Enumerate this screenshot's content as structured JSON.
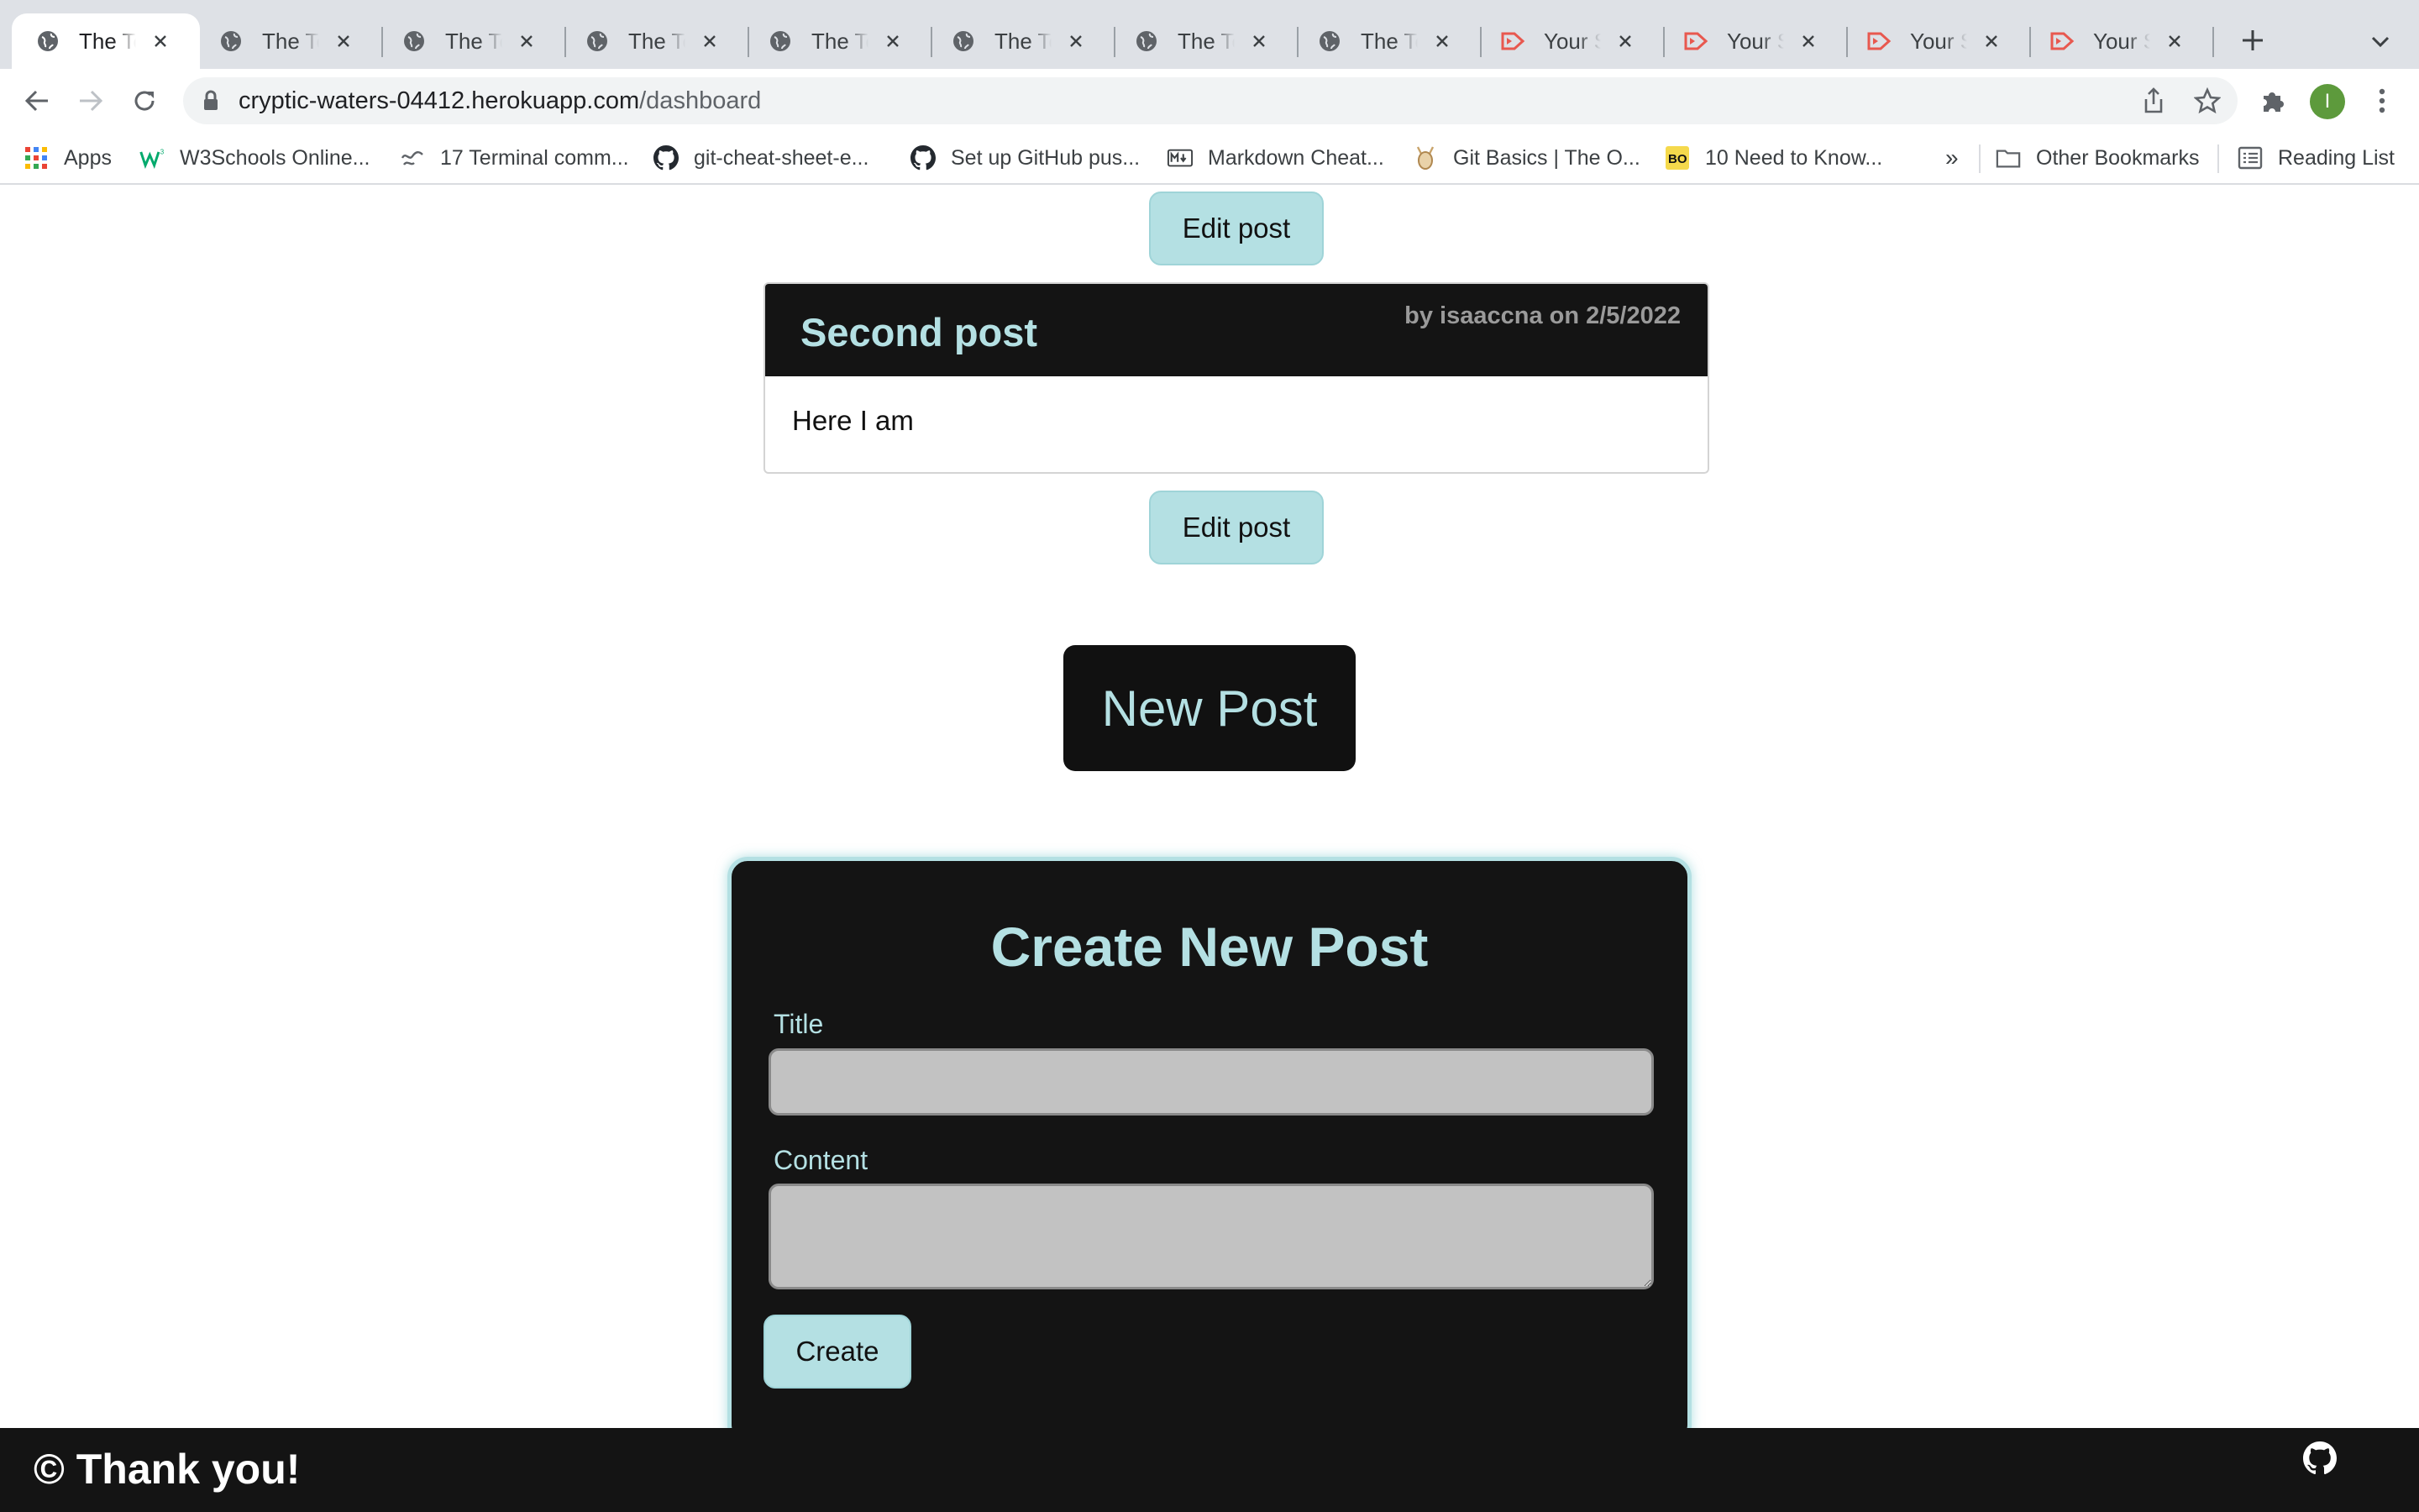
{
  "browser": {
    "tabs": [
      {
        "title": "The Tech Blog",
        "icon": "globe-icon",
        "active": true
      },
      {
        "title": "The Tech Blog",
        "icon": "globe-icon",
        "active": false
      },
      {
        "title": "The Tech Blog",
        "icon": "globe-icon",
        "active": false
      },
      {
        "title": "The Tech Blog",
        "icon": "globe-icon",
        "active": false
      },
      {
        "title": "The Tech Blog",
        "icon": "globe-icon",
        "active": false
      },
      {
        "title": "The Tech Blog",
        "icon": "globe-icon",
        "active": false
      },
      {
        "title": "The Tech Blog",
        "icon": "globe-icon",
        "active": false
      },
      {
        "title": "The Tech Blog",
        "icon": "globe-icon",
        "active": false
      },
      {
        "title": "Your Screencastify",
        "icon": "screencastify-icon",
        "active": false
      },
      {
        "title": "Your Screencastify",
        "icon": "screencastify-icon",
        "active": false
      },
      {
        "title": "Your Screencastify",
        "icon": "screencastify-icon",
        "active": false
      },
      {
        "title": "Your Screencastify",
        "icon": "screencastify-icon",
        "active": false
      }
    ],
    "address": {
      "host": "cryptic-waters-04412.herokuapp.com",
      "path": "/dashboard"
    },
    "profile_initial": "I",
    "bookmarks": [
      {
        "label": "Apps",
        "icon": "apps-grid-icon"
      },
      {
        "label": "W3Schools Online...",
        "icon": "w3schools-icon"
      },
      {
        "label": "17 Terminal comm...",
        "icon": "terminal-icon"
      },
      {
        "label": "git-cheat-sheet-e...",
        "icon": "github-icon"
      },
      {
        "label": "Set up GitHub pus...",
        "icon": "github-icon"
      },
      {
        "label": "Markdown Cheat...",
        "icon": "markdown-icon"
      },
      {
        "label": "Git Basics | The O...",
        "icon": "odin-icon"
      },
      {
        "label": "10 Need to Know...",
        "icon": "bo-icon"
      }
    ],
    "bookmarks_overflow": "»",
    "other_bookmarks": "Other Bookmarks",
    "reading_list": "Reading List"
  },
  "page": {
    "edit_post_label": "Edit post",
    "post": {
      "title": "Second post",
      "meta": "by isaaccna on 2/5/2022",
      "body": "Here I am"
    },
    "new_post_label": "New Post",
    "form": {
      "title": "Create New Post",
      "title_label": "Title",
      "title_value": "",
      "content_label": "Content",
      "content_value": "",
      "submit_label": "Create"
    }
  },
  "footer": {
    "text": "© Thank you!",
    "icon": "github-icon"
  },
  "colors": {
    "accent": "#b4e0e3",
    "dark": "#141414",
    "input_bg": "#c2c2c2"
  }
}
